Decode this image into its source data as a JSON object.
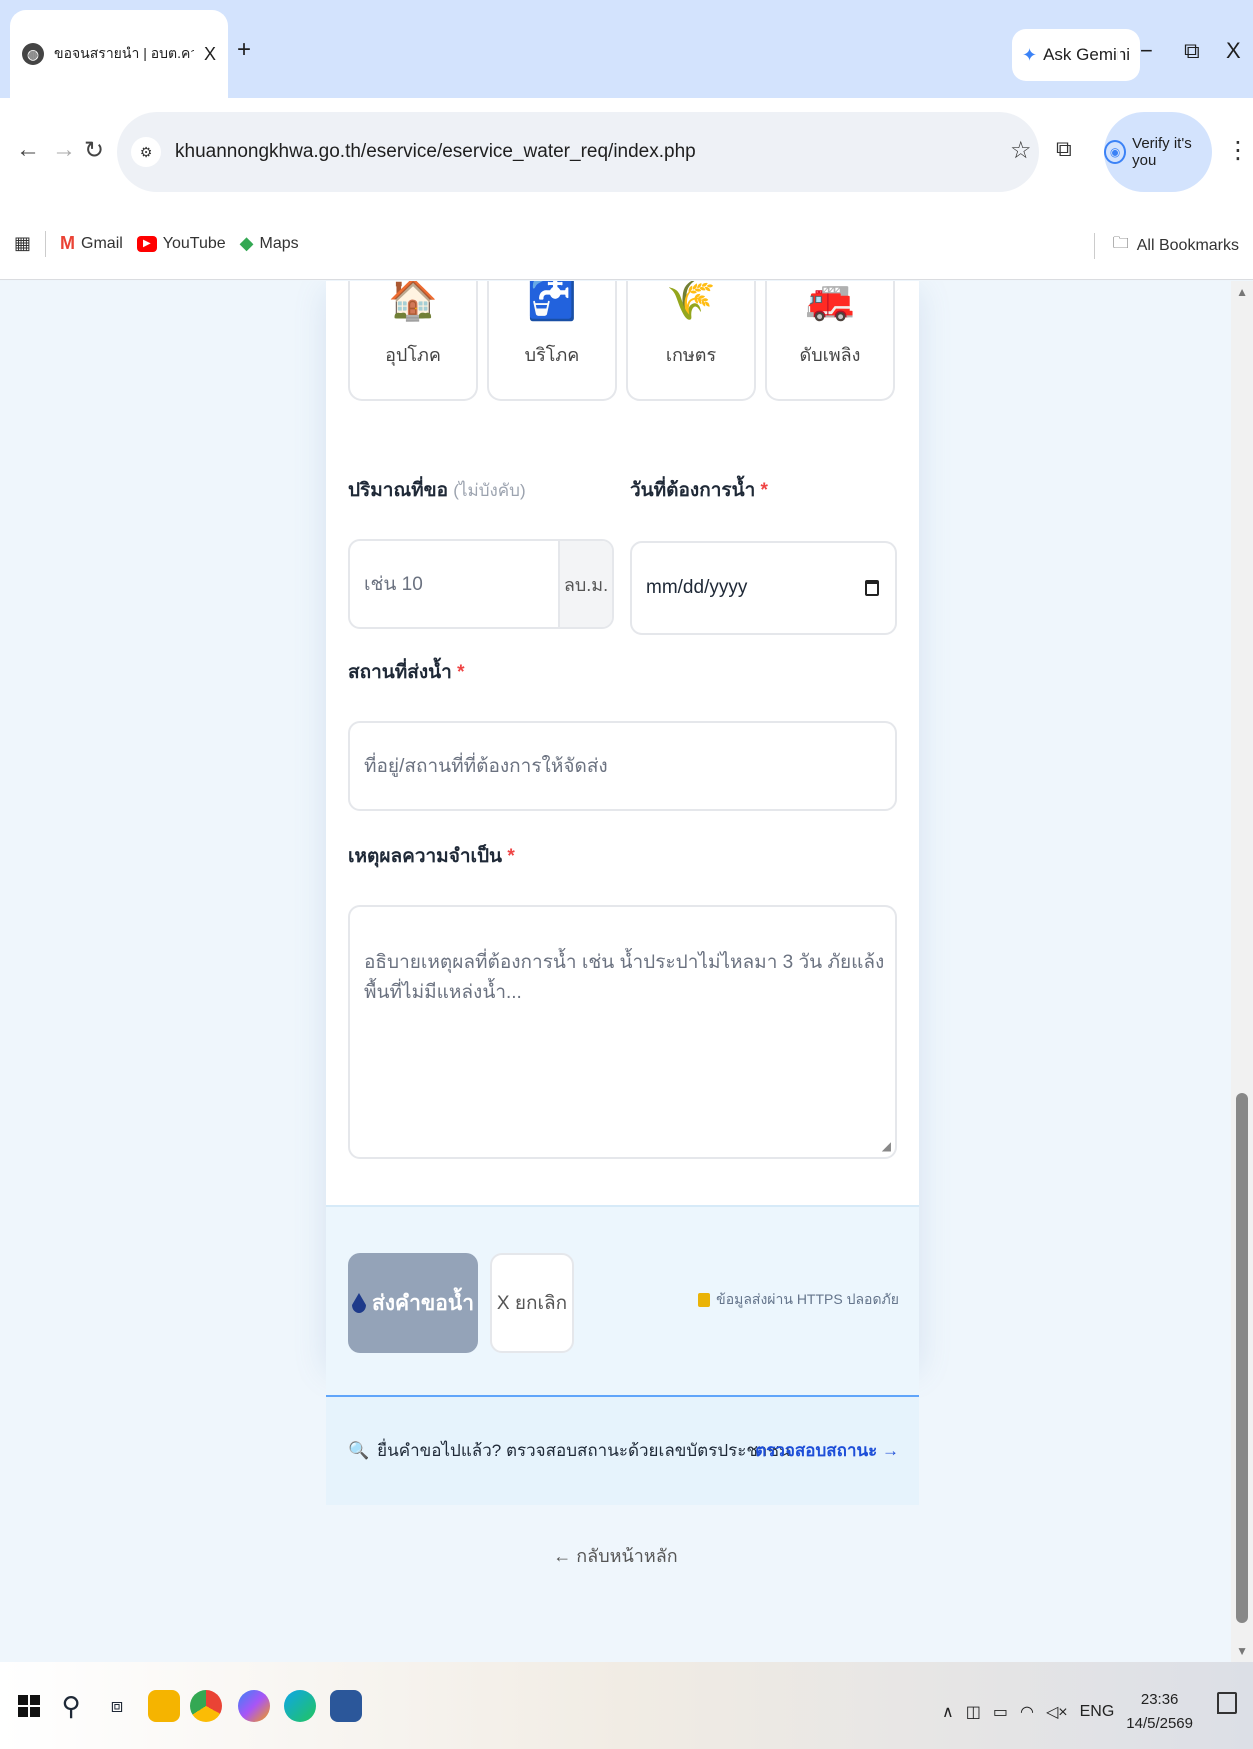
{
  "browser": {
    "tab_title": "ขอจนสรายนำ | อบต.ควนหนองคว้า",
    "tab_close": "X",
    "new_tab": "+",
    "ask_gemini": "Ask Gemini",
    "window_minimize": "−",
    "window_restore": "⧉",
    "window_close": "X",
    "url": "khuannongkhwa.go.th/eservice/eservice_water_req/index.php",
    "verify_label": "Verify it's you",
    "bookmarks": [
      {
        "label": "Gmail",
        "icon": "gmail-icon"
      },
      {
        "label": "YouTube",
        "icon": "youtube-icon"
      },
      {
        "label": "Maps",
        "icon": "maps-icon"
      }
    ],
    "all_bookmarks": "All Bookmarks"
  },
  "form": {
    "usage_types": [
      {
        "label": "อุปโภค",
        "icon": "🏠"
      },
      {
        "label": "บริโภค",
        "icon": "🚰"
      },
      {
        "label": "เกษตร",
        "icon": "🌾"
      },
      {
        "label": "ดับเพลิง",
        "icon": "🚒"
      }
    ],
    "quantity": {
      "label": "ปริมาณที่ขอ",
      "optional": "(ไม่บังคับ)",
      "placeholder": "เช่น 10",
      "unit": "ลบ.ม."
    },
    "date": {
      "label": "วันที่ต้องการน้ำ",
      "required_mark": "*",
      "placeholder": "mm/dd/yyyy"
    },
    "place": {
      "label": "สถานที่ส่งน้ำ",
      "required_mark": "*",
      "placeholder": "ที่อยู่/สถานที่ที่ต้องการให้จัดส่ง"
    },
    "reason": {
      "label": "เหตุผลความจำเป็น",
      "required_mark": "*",
      "placeholder": "อธิบายเหตุผลที่ต้องการน้ำ เช่น น้ำประปาไม่ไหลมา 3 วัน ภัยแล้ง พื้นที่ไม่มีแหล่งน้ำ..."
    },
    "submit_label": "ส่งคำขอน้ำ",
    "cancel_label": "X ยกเลิก",
    "secure_note": "ข้อมูลส่งผ่าน HTTPS ปลอดภัย",
    "status_question": "ยื่นคำขอไปแล้ว? ตรวจสอบสถานะด้วยเลขบัตรประชาชน",
    "status_link": "ตรวจสอบสถานะ →",
    "back_home": "← กลับหน้าหลัก"
  },
  "taskbar": {
    "tray_lang": "ENG",
    "time": "23:36",
    "date": "14/5/2569"
  },
  "colors": {
    "submit_bg": "#94a3b8",
    "link": "#1d4ed8",
    "required": "#ef4444",
    "page_bg": "#eff6fc"
  }
}
